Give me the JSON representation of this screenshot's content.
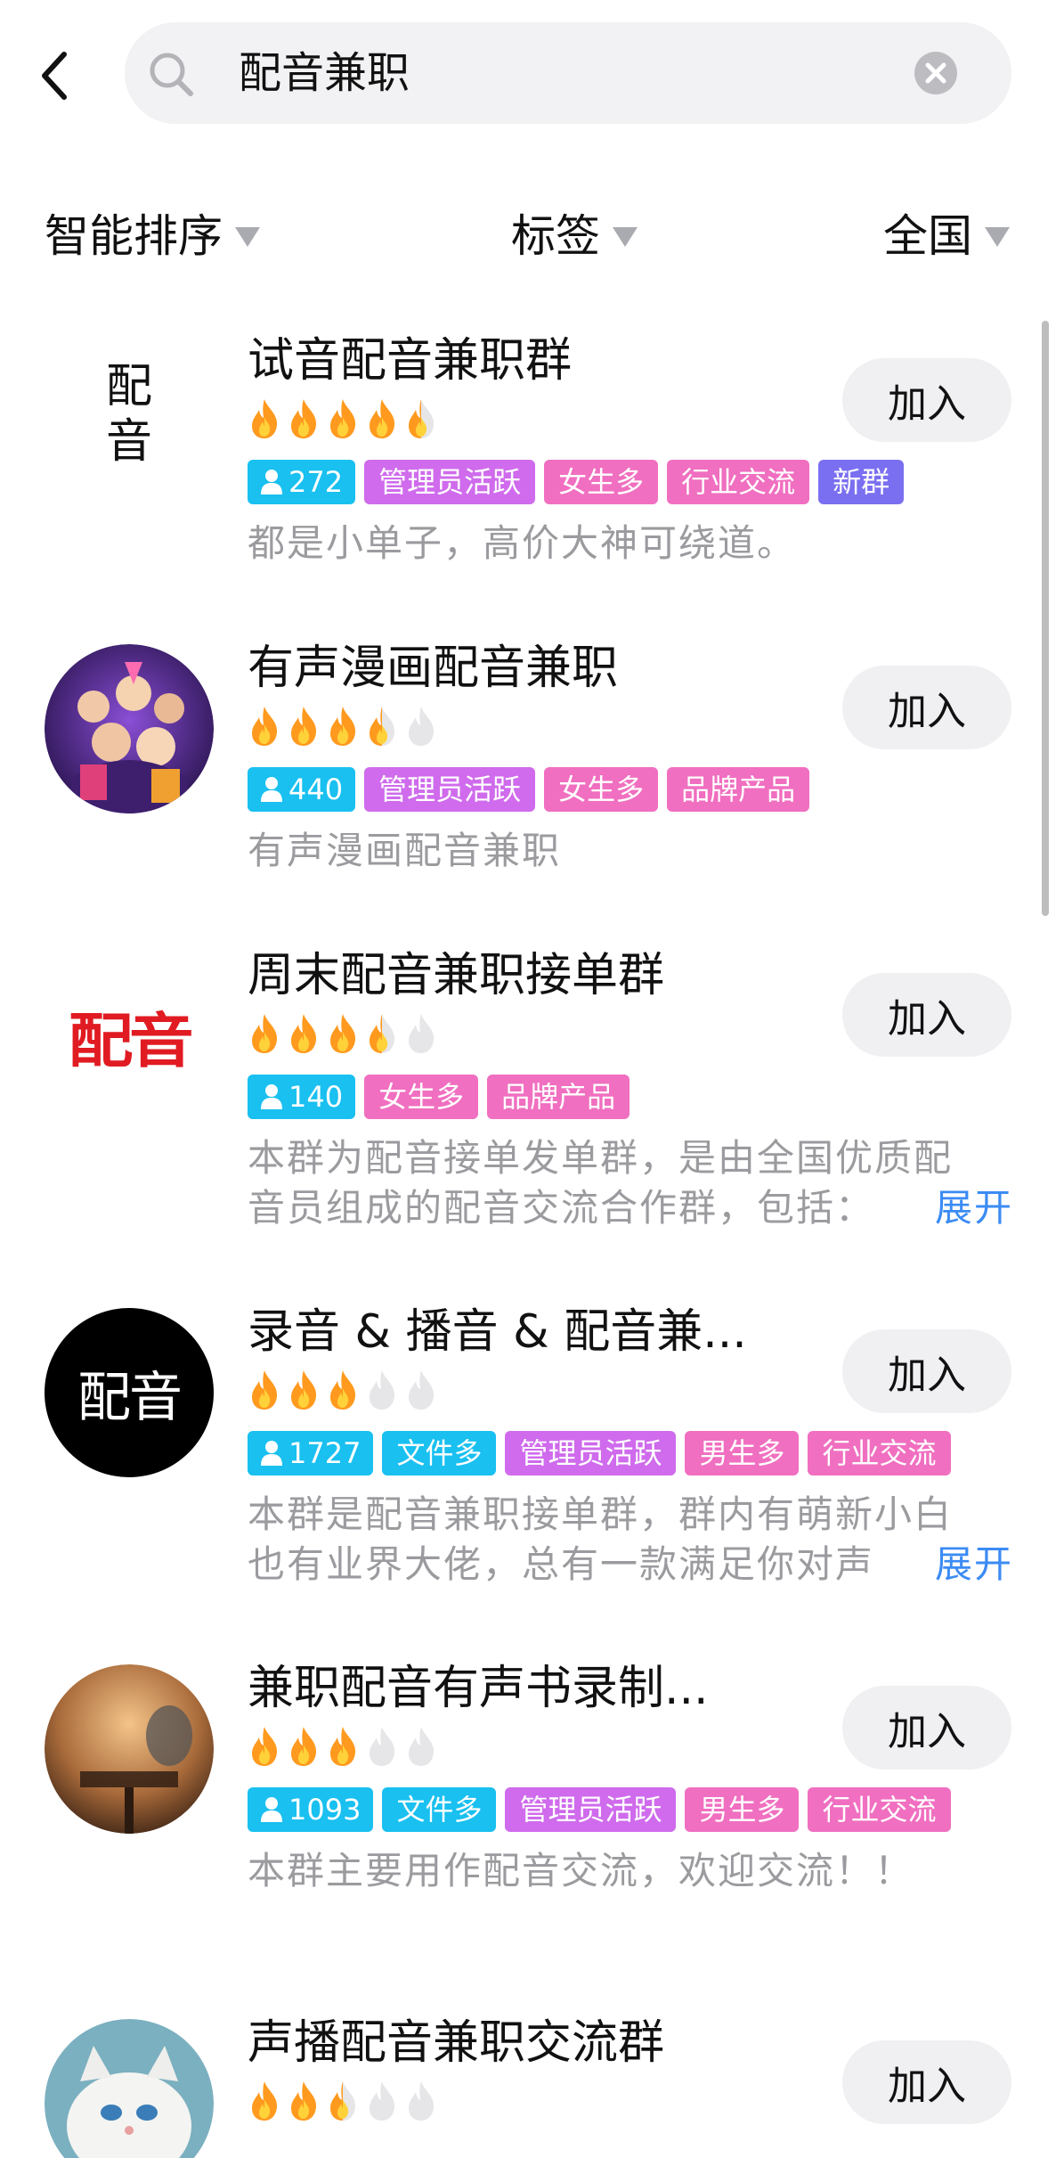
{
  "search": {
    "query": "配音兼职"
  },
  "filters": [
    {
      "label": "智能排序"
    },
    {
      "label": "标签"
    },
    {
      "label": "全国"
    }
  ],
  "join_label": "加入",
  "expand_label": "展开",
  "groups": [
    {
      "title": "试音配音兼职群",
      "avatar": {
        "type": "text-logo",
        "text1": "配",
        "text2": "音"
      },
      "flames": 4.5,
      "members": "272",
      "tags": [
        "管理员活跃",
        "女生多",
        "行业交流",
        "新群"
      ],
      "desc": [
        "都是小单子，高价大神可绕道。"
      ],
      "expandable": false
    },
    {
      "title": "有声漫画配音兼职",
      "avatar": {
        "type": "illustration"
      },
      "flames": 3.5,
      "members": "440",
      "tags": [
        "管理员活跃",
        "女生多",
        "品牌产品"
      ],
      "desc": [
        "有声漫画配音兼职"
      ],
      "expandable": false
    },
    {
      "title": "周末配音兼职接单群",
      "avatar": {
        "type": "red-logo",
        "text": "配音"
      },
      "flames": 3.5,
      "members": "140",
      "tags": [
        "女生多",
        "品牌产品"
      ],
      "desc": [
        "本群为配音接单发单群，是由全国优质配",
        "音员组成的配音交流合作群，包括："
      ],
      "expandable": true
    },
    {
      "title": "录音 & 播音 & 配音兼...",
      "avatar": {
        "type": "black-logo",
        "text": "配音"
      },
      "flames": 3,
      "members": "1727",
      "tags": [
        "文件多",
        "管理员活跃",
        "男生多",
        "行业交流"
      ],
      "desc": [
        "本群是配音兼职接单群，群内有萌新小白",
        "也有业界大佬，总有一款满足你对声"
      ],
      "expandable": true
    },
    {
      "title": "兼职配音有声书录制...",
      "avatar": {
        "type": "photo-mic"
      },
      "flames": 3,
      "members": "1093",
      "tags": [
        "文件多",
        "管理员活跃",
        "男生多",
        "行业交流"
      ],
      "desc": [
        "本群主要用作配音交流，欢迎交流！！"
      ],
      "expandable": false
    },
    {
      "title": "声播配音兼职交流群",
      "avatar": {
        "type": "photo-cat"
      },
      "flames": 2.5,
      "members": "",
      "tags": [],
      "desc": [],
      "expandable": false
    }
  ],
  "tag_colors": {
    "管理员活跃": "#cf6bec",
    "女生多": "#f06fc0",
    "行业交流": "#f06fc0",
    "新群": "#7a6ff0",
    "品牌产品": "#f06fc0",
    "文件多": "#19c0f0",
    "男生多": "#f06fc0"
  },
  "colors": {
    "flame_active": "#ff9a1f",
    "flame_inactive": "#e6e6e8",
    "link": "#3b8bf4",
    "muted_text": "#9b9b9f"
  }
}
